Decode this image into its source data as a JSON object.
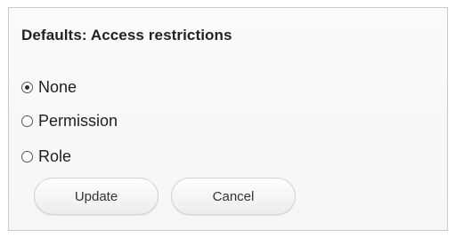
{
  "dialog": {
    "title": "Defaults: Access restrictions",
    "options": [
      {
        "label": "None",
        "selected": true
      },
      {
        "label": "Permission",
        "selected": false
      },
      {
        "label": "Role",
        "selected": false
      }
    ],
    "buttons": {
      "update_label": "Update",
      "cancel_label": "Cancel"
    }
  }
}
